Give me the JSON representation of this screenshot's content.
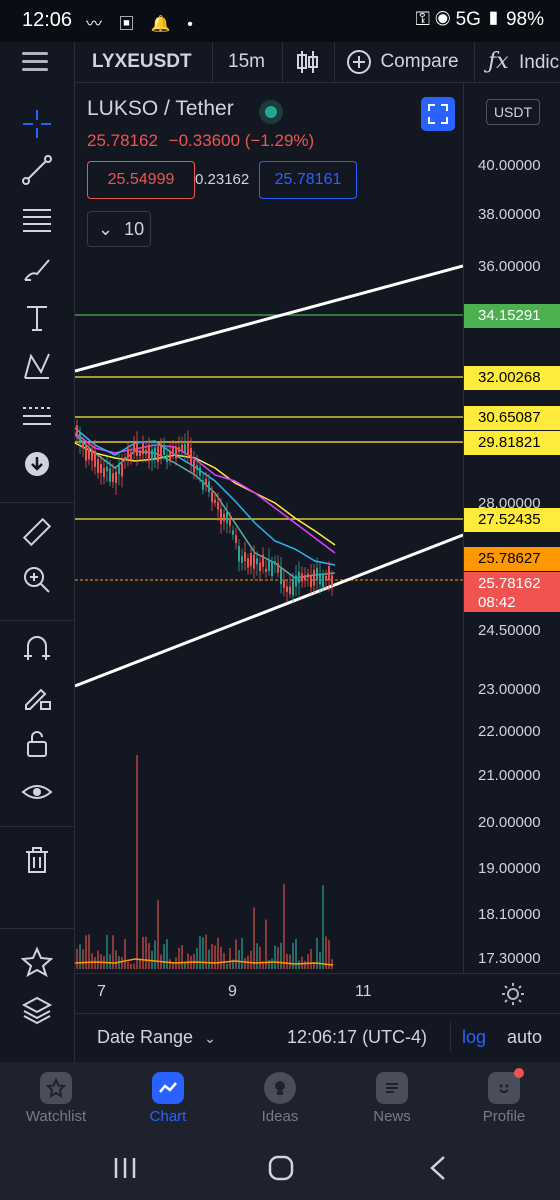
{
  "status_bar": {
    "time": "12:06",
    "network": "5G",
    "battery": "98%"
  },
  "toolbar": {
    "symbol": "LYXEUSDT",
    "interval": "15m",
    "compare_label": "Compare",
    "indicators_label": "Indic"
  },
  "legend": {
    "title": "LUKSO / Tether",
    "last_price": "25.78162",
    "change": "−0.33600 (−1.29%)",
    "bid": "25.54999",
    "spread": "0.23162",
    "ask": "25.78161",
    "indicator_count": "10"
  },
  "price_axis": {
    "currency": "USDT",
    "labels": [
      "40.00000",
      "38.00000",
      "36.00000",
      "28.00000",
      "24.50000",
      "23.00000",
      "22.00000",
      "21.00000",
      "20.00000",
      "19.00000",
      "18.10000",
      "17.30000"
    ],
    "tags": [
      {
        "value": "34.15291",
        "color": "#4caf50",
        "text_color": "#ffffff"
      },
      {
        "value": "32.00268",
        "color": "#ffeb3b",
        "text_color": "#000000"
      },
      {
        "value": "30.65087",
        "color": "#ffeb3b",
        "text_color": "#000000"
      },
      {
        "value": "29.81821",
        "color": "#ffeb3b",
        "text_color": "#000000"
      },
      {
        "value": "27.52435",
        "color": "#ffeb3b",
        "text_color": "#000000"
      },
      {
        "value": "25.78627",
        "color": "#ff9800",
        "text_color": "#000000"
      }
    ],
    "current": {
      "value": "25.78162",
      "countdown": "08:42",
      "color": "#f05350"
    }
  },
  "time_axis": {
    "labels": [
      "7",
      "9",
      "11"
    ]
  },
  "range_bar": {
    "date_range": "Date Range",
    "clock": "12:06:17 (UTC-4)",
    "log": "log",
    "auto": "auto"
  },
  "bottom_nav": [
    {
      "label": "Watchlist",
      "icon": "star-icon",
      "active": false
    },
    {
      "label": "Chart",
      "icon": "chart-icon",
      "active": true
    },
    {
      "label": "Ideas",
      "icon": "lightbulb-icon",
      "active": false
    },
    {
      "label": "News",
      "icon": "news-icon",
      "active": false
    },
    {
      "label": "Profile",
      "icon": "profile-icon",
      "active": false
    }
  ],
  "colors": {
    "background": "#131722",
    "accent": "#2962ff",
    "up": "#26a69a",
    "down": "#ef5350",
    "trendline": "#ffffff",
    "level_yellow": "#ffeb3b",
    "level_green": "#4caf50"
  }
}
